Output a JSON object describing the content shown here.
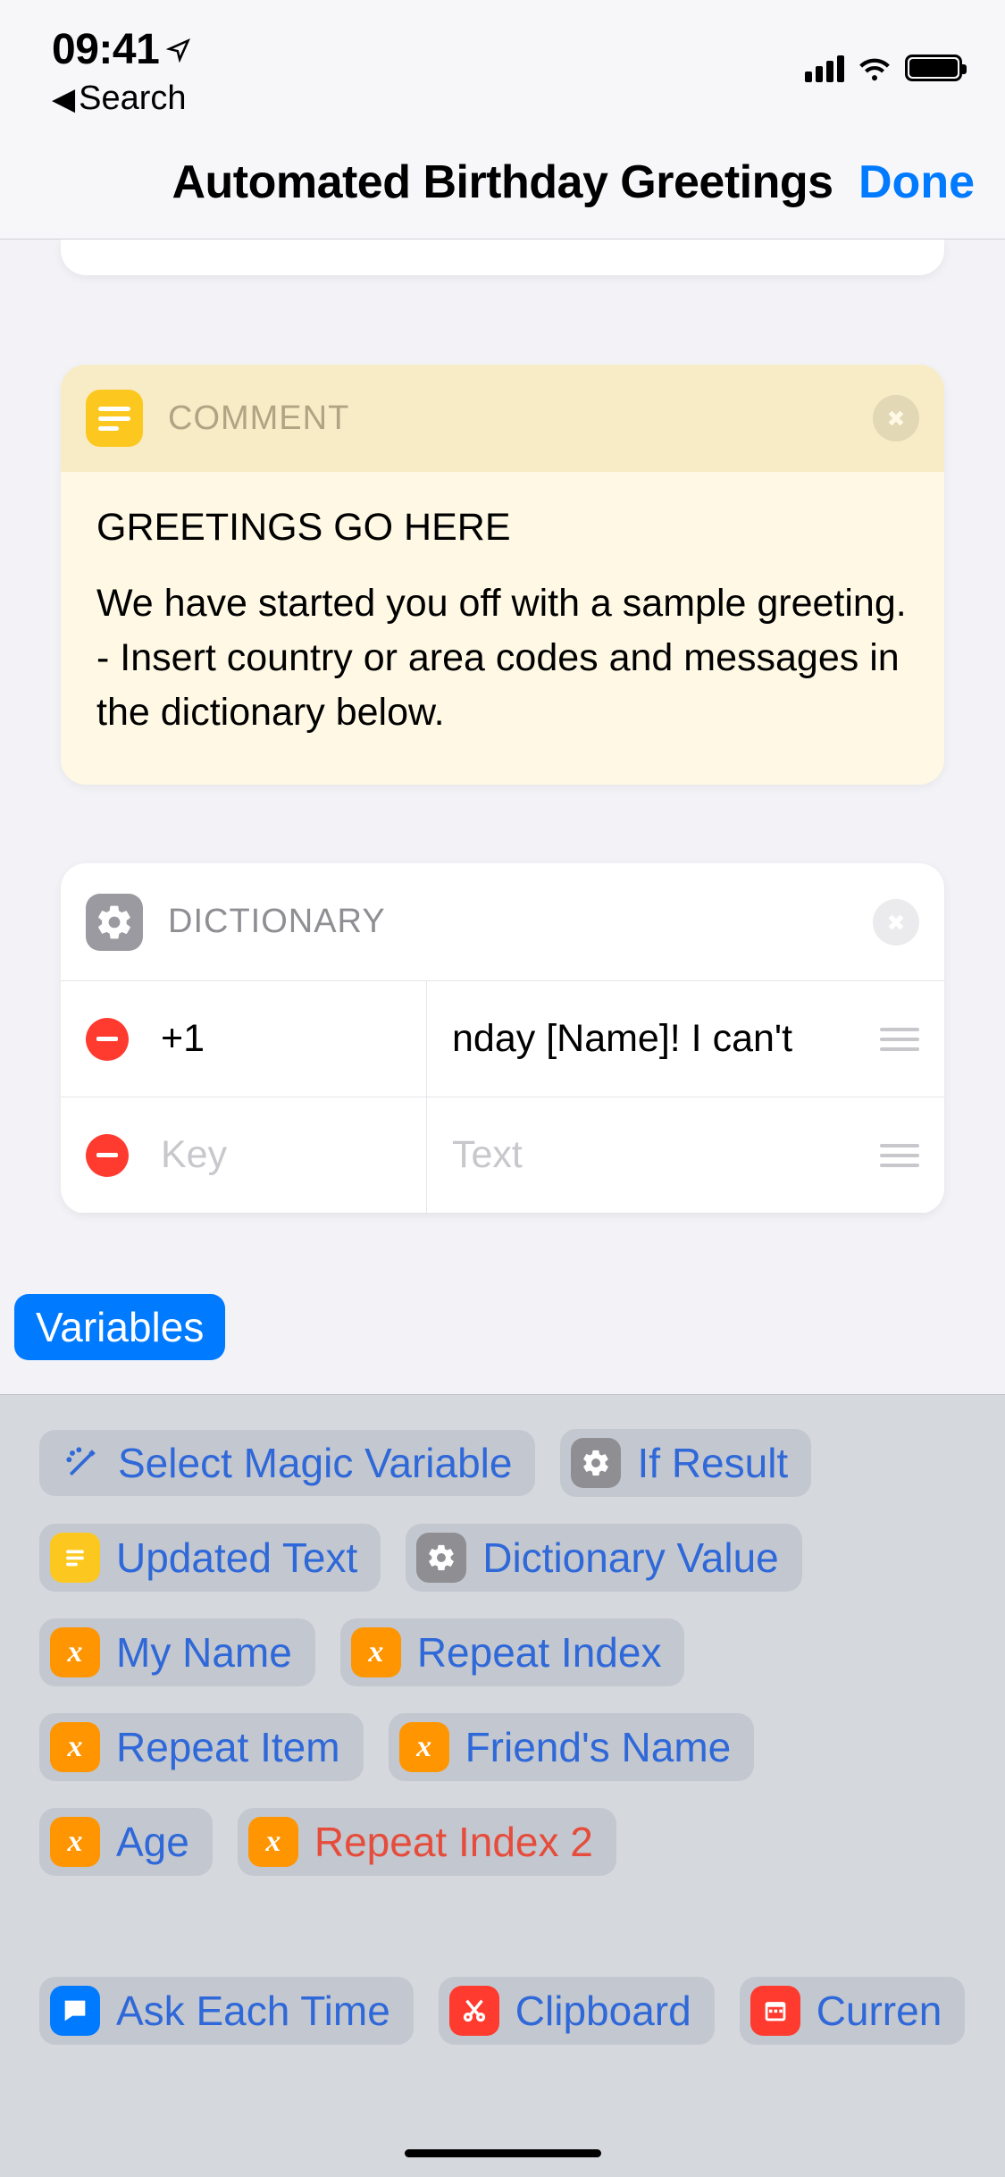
{
  "status": {
    "time": "09:41",
    "back_label": "Search"
  },
  "nav": {
    "title": "Automated Birthday Greetings",
    "done": "Done"
  },
  "comment": {
    "header": "COMMENT",
    "body_line1": "GREETINGS GO HERE",
    "body_line2": "We have started you off with a sample greeting.",
    "body_line3": "- Insert country or area codes and messages in the dictionary below."
  },
  "dictionary": {
    "header": "DICTIONARY",
    "rows": [
      {
        "key": "+1",
        "value": "nday [Name]! I can't",
        "key_placeholder": "",
        "value_placeholder": ""
      },
      {
        "key": "",
        "value": "",
        "key_placeholder": "Key",
        "value_placeholder": "Text"
      }
    ]
  },
  "variables_chip": "Variables",
  "var_pills": {
    "magic": "Select Magic Variable",
    "if_result": "If Result",
    "updated_text": "Updated Text",
    "dictionary_value": "Dictionary Value",
    "my_name": "My Name",
    "repeat_index": "Repeat Index",
    "repeat_item": "Repeat Item",
    "friends_name": "Friend's Name",
    "age": "Age",
    "repeat_index_2": "Repeat Index 2",
    "ask_each_time": "Ask Each Time",
    "clipboard": "Clipboard",
    "current": "Curren"
  }
}
